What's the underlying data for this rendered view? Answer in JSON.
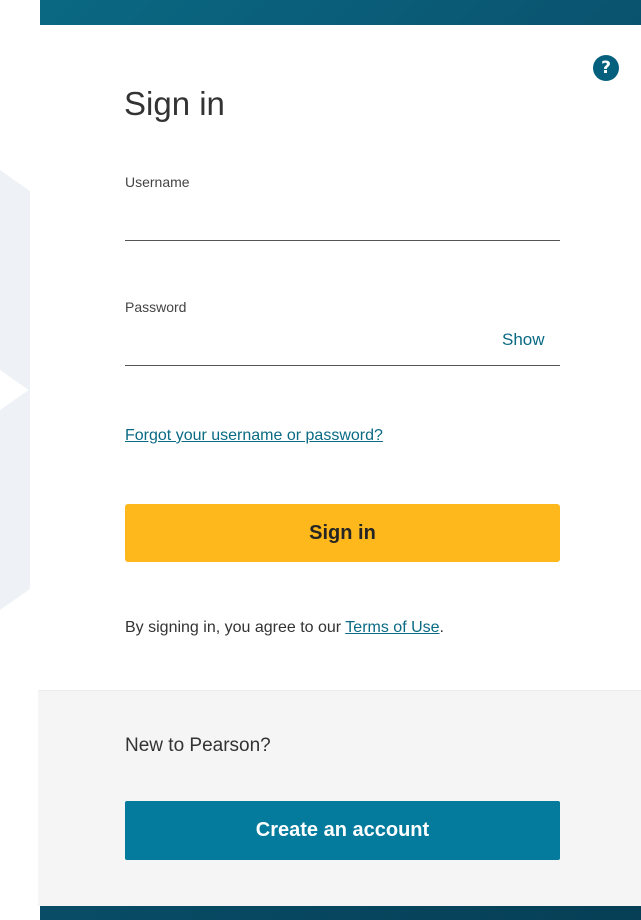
{
  "help": {
    "icon": "question-icon",
    "glyph": "?"
  },
  "signin": {
    "title": "Sign in",
    "username_label": "Username",
    "username_value": "",
    "password_label": "Password",
    "password_value": "",
    "show_label": "Show",
    "forgot_link": "Forgot your username or password?",
    "button_label": "Sign in",
    "terms_prefix": "By signing in, you agree to our ",
    "terms_link": "Terms of Use",
    "terms_suffix": "."
  },
  "register": {
    "prompt": "New to Pearson?",
    "button_label": "Create an account"
  },
  "colors": {
    "background": "#0a5470",
    "accent": "#0a6a84",
    "signin_button": "#ffb81c",
    "create_button": "#047a9c",
    "footer": "#f5f5f5"
  }
}
